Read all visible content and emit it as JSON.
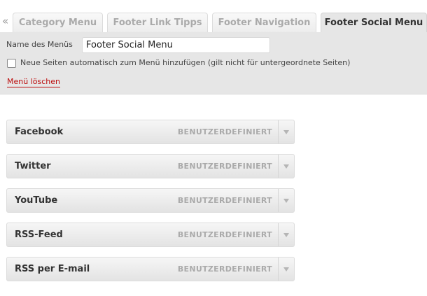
{
  "tabs": {
    "scroll_arrow": "«",
    "items": [
      {
        "label": "Category Menu"
      },
      {
        "label": "Footer Link Tipps"
      },
      {
        "label": "Footer Navigation"
      },
      {
        "label": "Footer Social Menu"
      }
    ],
    "active_index": 3
  },
  "header": {
    "name_label": "Name des Menüs",
    "name_value": "Footer Social Menu",
    "auto_add_label": "Neue Seiten automatisch zum Menü hinzufügen (gilt nicht für untergeordnete Seiten)",
    "auto_add_checked": false,
    "delete_label": "Menü löschen"
  },
  "menu_items": [
    {
      "title": "Facebook",
      "type": "BENUTZERDEFINIERT"
    },
    {
      "title": "Twitter",
      "type": "BENUTZERDEFINIERT"
    },
    {
      "title": "YouTube",
      "type": "BENUTZERDEFINIERT"
    },
    {
      "title": "RSS-Feed",
      "type": "BENUTZERDEFINIERT"
    },
    {
      "title": "RSS per E-mail",
      "type": "BENUTZERDEFINIERT"
    }
  ],
  "colors": {
    "link_red": "#bc0b0b",
    "panel_bg": "#e6e6e6"
  },
  "icons": {
    "scroll": "double-chevron-left-icon",
    "item_toggle": "triangle-down-icon"
  }
}
